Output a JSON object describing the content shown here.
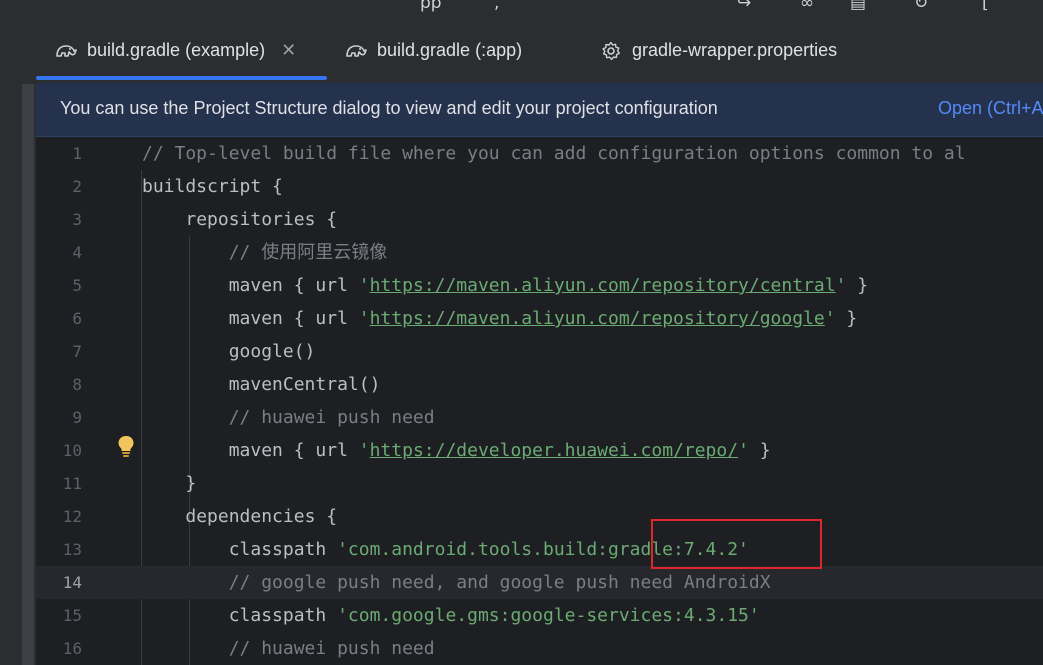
{
  "tabs": [
    {
      "label": "build.gradle (example)",
      "icon": "gradle-elephant-icon",
      "active": true,
      "closable": true
    },
    {
      "label": "build.gradle (:app)",
      "icon": "gradle-elephant-icon",
      "active": false
    },
    {
      "label": "gradle-wrapper.properties",
      "icon": "gear-icon",
      "active": false
    }
  ],
  "banner": {
    "message": "You can use the Project Structure dialog to view and edit your project configuration",
    "action": "Open (Ctrl+A"
  },
  "editor": {
    "current_line": 14,
    "lines": [
      {
        "num": "1",
        "indent": "",
        "parts": [
          {
            "c": "cmt",
            "t": "// Top-level build file where you can add configuration options common to al"
          }
        ]
      },
      {
        "num": "2",
        "indent": "",
        "parts": [
          {
            "c": "kw",
            "t": "buildscript {"
          }
        ]
      },
      {
        "num": "3",
        "indent": "    ",
        "parts": [
          {
            "c": "kw",
            "t": "repositories {"
          }
        ]
      },
      {
        "num": "4",
        "indent": "        ",
        "parts": [
          {
            "c": "cmt",
            "t": "// 使用阿里云镜像"
          }
        ]
      },
      {
        "num": "5",
        "indent": "        ",
        "parts": [
          {
            "c": "kw",
            "t": "maven { url "
          },
          {
            "c": "str",
            "t": "'"
          },
          {
            "c": "url",
            "t": "https://maven.aliyun.com/repository/central"
          },
          {
            "c": "str",
            "t": "'"
          },
          {
            "c": "kw",
            "t": " }"
          }
        ]
      },
      {
        "num": "6",
        "indent": "        ",
        "parts": [
          {
            "c": "kw",
            "t": "maven { url "
          },
          {
            "c": "str",
            "t": "'"
          },
          {
            "c": "url",
            "t": "https://maven.aliyun.com/repository/google"
          },
          {
            "c": "str",
            "t": "'"
          },
          {
            "c": "kw",
            "t": " }"
          }
        ]
      },
      {
        "num": "7",
        "indent": "        ",
        "parts": [
          {
            "c": "kw",
            "t": "google()"
          }
        ]
      },
      {
        "num": "8",
        "indent": "        ",
        "parts": [
          {
            "c": "kw",
            "t": "mavenCentral()"
          }
        ]
      },
      {
        "num": "9",
        "indent": "        ",
        "parts": [
          {
            "c": "cmt",
            "t": "// huawei push need"
          }
        ]
      },
      {
        "num": "10",
        "indent": "        ",
        "parts": [
          {
            "c": "kw",
            "t": "maven { url "
          },
          {
            "c": "str",
            "t": "'"
          },
          {
            "c": "url",
            "t": "https://developer.huawei.com/repo/"
          },
          {
            "c": "str",
            "t": "'"
          },
          {
            "c": "kw",
            "t": " }"
          }
        ]
      },
      {
        "num": "11",
        "indent": "    ",
        "parts": [
          {
            "c": "kw",
            "t": "}"
          }
        ]
      },
      {
        "num": "12",
        "indent": "    ",
        "parts": [
          {
            "c": "kw",
            "t": "dependencies {"
          }
        ]
      },
      {
        "num": "13",
        "indent": "        ",
        "parts": [
          {
            "c": "kw",
            "t": "classpath "
          },
          {
            "c": "str",
            "t": "'com.android.tools.build:gradle:7.4.2'"
          }
        ]
      },
      {
        "num": "14",
        "indent": "        ",
        "parts": [
          {
            "c": "cmt",
            "t": "// google push need, and google push need AndroidX"
          }
        ]
      },
      {
        "num": "15",
        "indent": "        ",
        "parts": [
          {
            "c": "kw",
            "t": "classpath "
          },
          {
            "c": "str",
            "t": "'com.google.gms:google-services:4.3.15'"
          }
        ]
      },
      {
        "num": "16",
        "indent": "        ",
        "parts": [
          {
            "c": "cmt",
            "t": "// huawei push need"
          }
        ]
      }
    ]
  },
  "colors": {
    "accent": "#3574f0",
    "banner_bg": "#25324d",
    "link": "#548af7",
    "string": "#6aab73",
    "comment": "#7a7e85",
    "highlight_box": "#e0262b"
  }
}
